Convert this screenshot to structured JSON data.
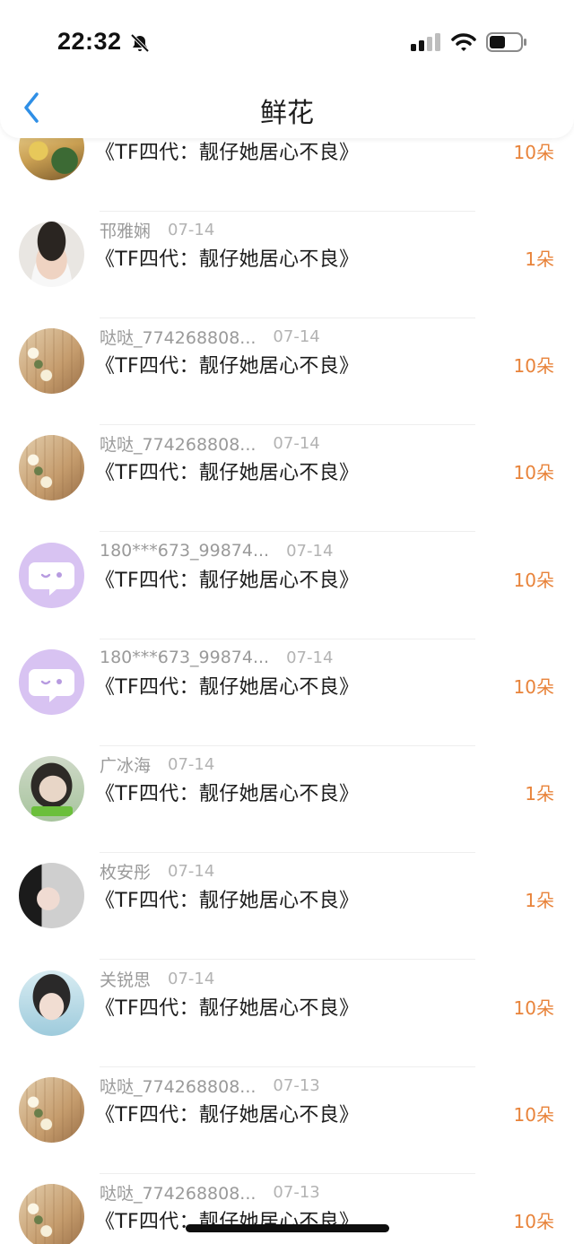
{
  "status_bar": {
    "time": "22:32",
    "icons": [
      "bell-slash-icon",
      "cellular-signal-icon",
      "wifi-icon",
      "battery-icon"
    ]
  },
  "nav": {
    "title": "鲜花",
    "back_icon": "chevron-left-icon"
  },
  "colors": {
    "accent_count": "#e8833a",
    "back_blue": "#2f8fe6",
    "name_gray": "#9a9a9a",
    "chat_avatar_bg": "#d8c3f2"
  },
  "gifts": [
    {
      "name": "",
      "date": "",
      "title": "《TF四代：靓仔她居心不良》",
      "count": "10朵",
      "avatar": "anime"
    },
    {
      "name": "邗雅娴",
      "date": "07-14",
      "title": "《TF四代：靓仔她居心不良》",
      "count": "1朵",
      "avatar": "boy"
    },
    {
      "name": "哒哒_774268808...",
      "date": "07-14",
      "title": "《TF四代：靓仔她居心不良》",
      "count": "10朵",
      "avatar": "flower"
    },
    {
      "name": "哒哒_774268808...",
      "date": "07-14",
      "title": "《TF四代：靓仔她居心不良》",
      "count": "10朵",
      "avatar": "flower"
    },
    {
      "name": "180***673_99874...",
      "date": "07-14",
      "title": "《TF四代：靓仔她居心不良》",
      "count": "10朵",
      "avatar": "chat"
    },
    {
      "name": "180***673_99874...",
      "date": "07-14",
      "title": "《TF四代：靓仔她居心不良》",
      "count": "10朵",
      "avatar": "chat"
    },
    {
      "name": "广冰海",
      "date": "07-14",
      "title": "《TF四代：靓仔她居心不良》",
      "count": "1朵",
      "avatar": "girl1"
    },
    {
      "name": "枚安彤",
      "date": "07-14",
      "title": "《TF四代：靓仔她居心不良》",
      "count": "1朵",
      "avatar": "hand"
    },
    {
      "name": "关锐思",
      "date": "07-14",
      "title": "《TF四代：靓仔她居心不良》",
      "count": "10朵",
      "avatar": "girl2"
    },
    {
      "name": "哒哒_774268808...",
      "date": "07-13",
      "title": "《TF四代：靓仔她居心不良》",
      "count": "10朵",
      "avatar": "flower"
    },
    {
      "name": "哒哒_774268808...",
      "date": "07-13",
      "title": "《TF四代：靓仔她居心不良》",
      "count": "10朵",
      "avatar": "flower"
    }
  ]
}
